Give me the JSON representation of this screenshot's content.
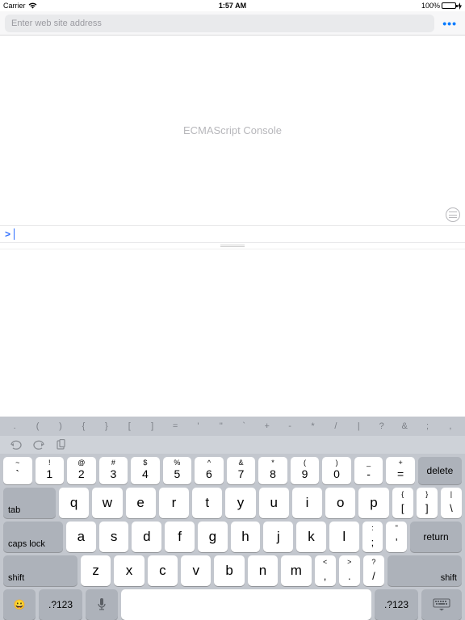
{
  "status": {
    "carrier": "Carrier",
    "time": "1:57 AM",
    "battery": "100%"
  },
  "url": {
    "placeholder": "Enter web site address",
    "more": "•••"
  },
  "console": {
    "label": "ECMAScript Console",
    "prompt": ">"
  },
  "symrow": [
    ".",
    "(",
    ")",
    "{",
    "}",
    "[",
    "]",
    "=",
    "'",
    "\"",
    "`",
    "+",
    "-",
    "*",
    "/",
    "|",
    "?",
    "&",
    ";",
    ","
  ],
  "row_num": [
    {
      "s": "~",
      "m": "`"
    },
    {
      "s": "!",
      "m": "1"
    },
    {
      "s": "@",
      "m": "2"
    },
    {
      "s": "#",
      "m": "3"
    },
    {
      "s": "$",
      "m": "4"
    },
    {
      "s": "%",
      "m": "5"
    },
    {
      "s": "^",
      "m": "6"
    },
    {
      "s": "&",
      "m": "7"
    },
    {
      "s": "*",
      "m": "8"
    },
    {
      "s": "(",
      "m": "9"
    },
    {
      "s": ")",
      "m": "0"
    },
    {
      "s": "_",
      "m": "-"
    },
    {
      "s": "+",
      "m": "="
    }
  ],
  "delete": "delete",
  "tab": "tab",
  "row_q": [
    "q",
    "w",
    "e",
    "r",
    "t",
    "y",
    "u",
    "i",
    "o",
    "p"
  ],
  "brackets": [
    {
      "s": "{",
      "m": "["
    },
    {
      "s": "}",
      "m": "]"
    },
    {
      "s": "|",
      "m": "\\"
    }
  ],
  "caps": "caps lock",
  "row_a": [
    "a",
    "s",
    "d",
    "f",
    "g",
    "h",
    "j",
    "k",
    "l"
  ],
  "semicol": {
    "s": ":",
    "m": ";"
  },
  "quote": {
    "s": "\"",
    "m": "'"
  },
  "return": "return",
  "shift": "shift",
  "row_z": [
    "z",
    "x",
    "c",
    "v",
    "b",
    "n",
    "m"
  ],
  "comma": {
    "s": "<",
    "m": ","
  },
  "period": {
    "s": ">",
    "m": "."
  },
  "slash": {
    "s": "?",
    "m": "/"
  },
  "numtoggle": ".?123",
  "emoji": "😀"
}
